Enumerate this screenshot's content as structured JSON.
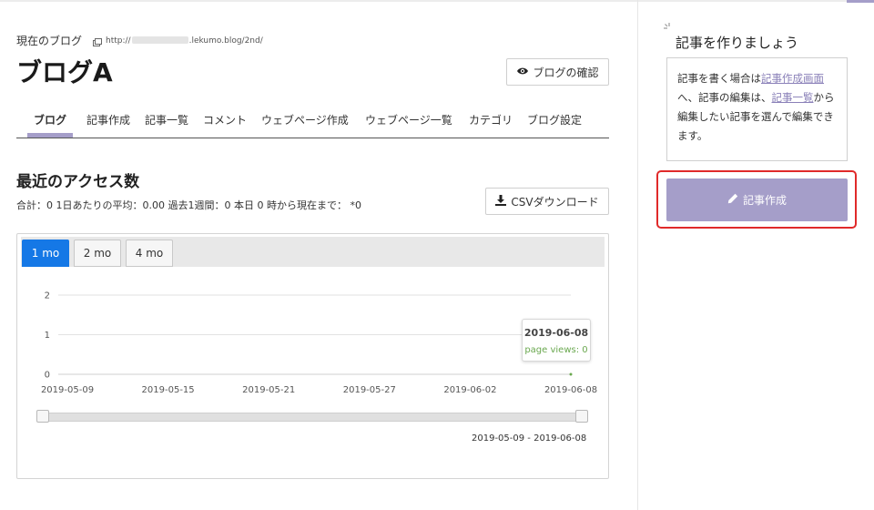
{
  "header": {
    "current_blog_label": "現在のブログ",
    "url_prefix": "http://",
    "url_suffix": ".lekumo.blog/2nd/",
    "blog_title": "ブログA",
    "confirm_label": "ブログの確認"
  },
  "tabs": [
    {
      "label": "ブログ",
      "active": true
    },
    {
      "label": "記事作成"
    },
    {
      "label": "記事一覧"
    },
    {
      "label": "コメント"
    },
    {
      "label": "ウェブページ作成"
    },
    {
      "label": "ウェブページ一覧"
    },
    {
      "label": "カテゴリ"
    },
    {
      "label": "ブログ設定"
    }
  ],
  "access": {
    "title": "最近のアクセス数",
    "summary": "合計：0 1日あたりの平均：0.00 過去1週間：0 本日 0 時から現在まで： *0",
    "csv_label": "CSVダウンロード"
  },
  "range_buttons": [
    {
      "label": "1 mo",
      "active": true
    },
    {
      "label": "2 mo"
    },
    {
      "label": "4 mo"
    }
  ],
  "chart_data": {
    "type": "line",
    "x_tick_labels": [
      "2019-05-09",
      "2019-05-15",
      "2019-05-21",
      "2019-05-27",
      "2019-06-02",
      "2019-06-08"
    ],
    "y_tick_labels": [
      "0",
      "1",
      "2"
    ],
    "ylim": [
      0,
      2
    ],
    "series": [
      {
        "name": "page views",
        "values": [
          0
        ]
      }
    ],
    "tooltip": {
      "date": "2019-06-08",
      "series": "page views",
      "value": "0"
    },
    "range_label": "2019-05-09 - 2019-06-08",
    "grid": true
  },
  "sidebar": {
    "title": "記事を作りましょう",
    "text_1": "記事を書く場合は",
    "link_1": "記事作成画面",
    "text_2": "へ、記事の編集は、",
    "link_2": "記事一覧",
    "text_3": "から編集したい記事を選んで編集できます。",
    "create_button": "記事作成"
  },
  "colors": {
    "accent": "#a59ec9",
    "active_range": "#1578e6",
    "highlight": "#e02a2a"
  }
}
